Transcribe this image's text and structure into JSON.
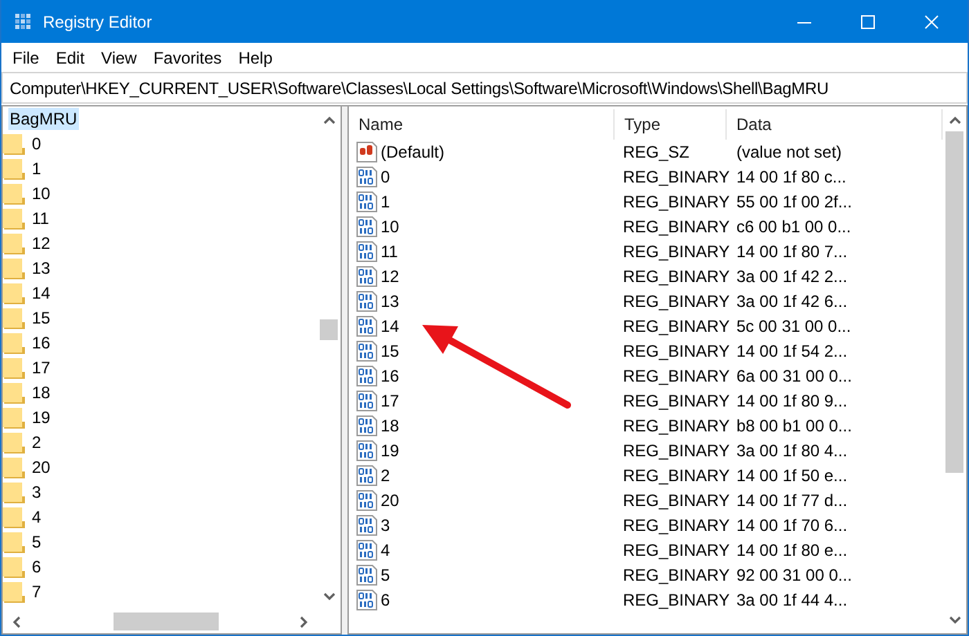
{
  "window": {
    "title": "Registry Editor"
  },
  "menu": [
    "File",
    "Edit",
    "View",
    "Favorites",
    "Help"
  ],
  "address": "Computer\\HKEY_CURRENT_USER\\Software\\Classes\\Local Settings\\Software\\Microsoft\\Windows\\Shell\\BagMRU",
  "tree": {
    "label": "BagMRU",
    "selected": true,
    "children": [
      {
        "label": "0",
        "selected": false
      },
      {
        "label": "1",
        "selected": false
      },
      {
        "label": "10",
        "selected": false
      },
      {
        "label": "11",
        "selected": false
      },
      {
        "label": "12",
        "selected": false
      },
      {
        "label": "13",
        "selected": false
      },
      {
        "label": "14",
        "selected": false
      },
      {
        "label": "15",
        "selected": false
      },
      {
        "label": "16",
        "selected": false
      },
      {
        "label": "17",
        "selected": false
      },
      {
        "label": "18",
        "selected": false
      },
      {
        "label": "19",
        "selected": false
      },
      {
        "label": "2",
        "selected": false
      },
      {
        "label": "20",
        "selected": false
      },
      {
        "label": "3",
        "selected": false
      },
      {
        "label": "4",
        "selected": false
      },
      {
        "label": "5",
        "selected": false
      },
      {
        "label": "6",
        "selected": false
      },
      {
        "label": "7",
        "selected": false
      }
    ]
  },
  "values": {
    "columns": [
      "Name",
      "Type",
      "Data"
    ],
    "rows": [
      {
        "kind": "string",
        "name": "(Default)",
        "type": "REG_SZ",
        "data": "(value not set)",
        "selected": false
      },
      {
        "kind": "binary",
        "name": "0",
        "type": "REG_BINARY",
        "data": "14 00 1f 80 c...",
        "selected": false
      },
      {
        "kind": "binary",
        "name": "1",
        "type": "REG_BINARY",
        "data": "55 00 1f 00 2f...",
        "selected": false
      },
      {
        "kind": "binary",
        "name": "10",
        "type": "REG_BINARY",
        "data": "c6 00 b1 00 0...",
        "selected": false
      },
      {
        "kind": "binary",
        "name": "11",
        "type": "REG_BINARY",
        "data": "14 00 1f 80 7...",
        "selected": false
      },
      {
        "kind": "binary",
        "name": "12",
        "type": "REG_BINARY",
        "data": "3a 00 1f 42 2...",
        "selected": false
      },
      {
        "kind": "binary",
        "name": "13",
        "type": "REG_BINARY",
        "data": "3a 00 1f 42 6...",
        "selected": false
      },
      {
        "kind": "binary",
        "name": "14",
        "type": "REG_BINARY",
        "data": "5c 00 31 00 0...",
        "selected": false
      },
      {
        "kind": "binary",
        "name": "15",
        "type": "REG_BINARY",
        "data": "14 00 1f 54 2...",
        "selected": false
      },
      {
        "kind": "binary",
        "name": "16",
        "type": "REG_BINARY",
        "data": "6a 00 31 00 0...",
        "selected": false
      },
      {
        "kind": "binary",
        "name": "17",
        "type": "REG_BINARY",
        "data": "14 00 1f 80 9...",
        "selected": false
      },
      {
        "kind": "binary",
        "name": "18",
        "type": "REG_BINARY",
        "data": "b8 00 b1 00 0...",
        "selected": false
      },
      {
        "kind": "binary",
        "name": "19",
        "type": "REG_BINARY",
        "data": "3a 00 1f 80 4...",
        "selected": false
      },
      {
        "kind": "binary",
        "name": "2",
        "type": "REG_BINARY",
        "data": "14 00 1f 50 e...",
        "selected": false
      },
      {
        "kind": "binary",
        "name": "20",
        "type": "REG_BINARY",
        "data": "14 00 1f 77 d...",
        "selected": false
      },
      {
        "kind": "binary",
        "name": "3",
        "type": "REG_BINARY",
        "data": "14 00 1f 70 6...",
        "selected": false
      },
      {
        "kind": "binary",
        "name": "4",
        "type": "REG_BINARY",
        "data": "14 00 1f 80 e...",
        "selected": false
      },
      {
        "kind": "binary",
        "name": "5",
        "type": "REG_BINARY",
        "data": "92 00 31 00 0...",
        "selected": false
      },
      {
        "kind": "binary",
        "name": "6",
        "type": "REG_BINARY",
        "data": "3a 00 1f 44 4...",
        "selected": false
      }
    ]
  },
  "annotations": [
    {
      "kind": "arrow"
    }
  ]
}
